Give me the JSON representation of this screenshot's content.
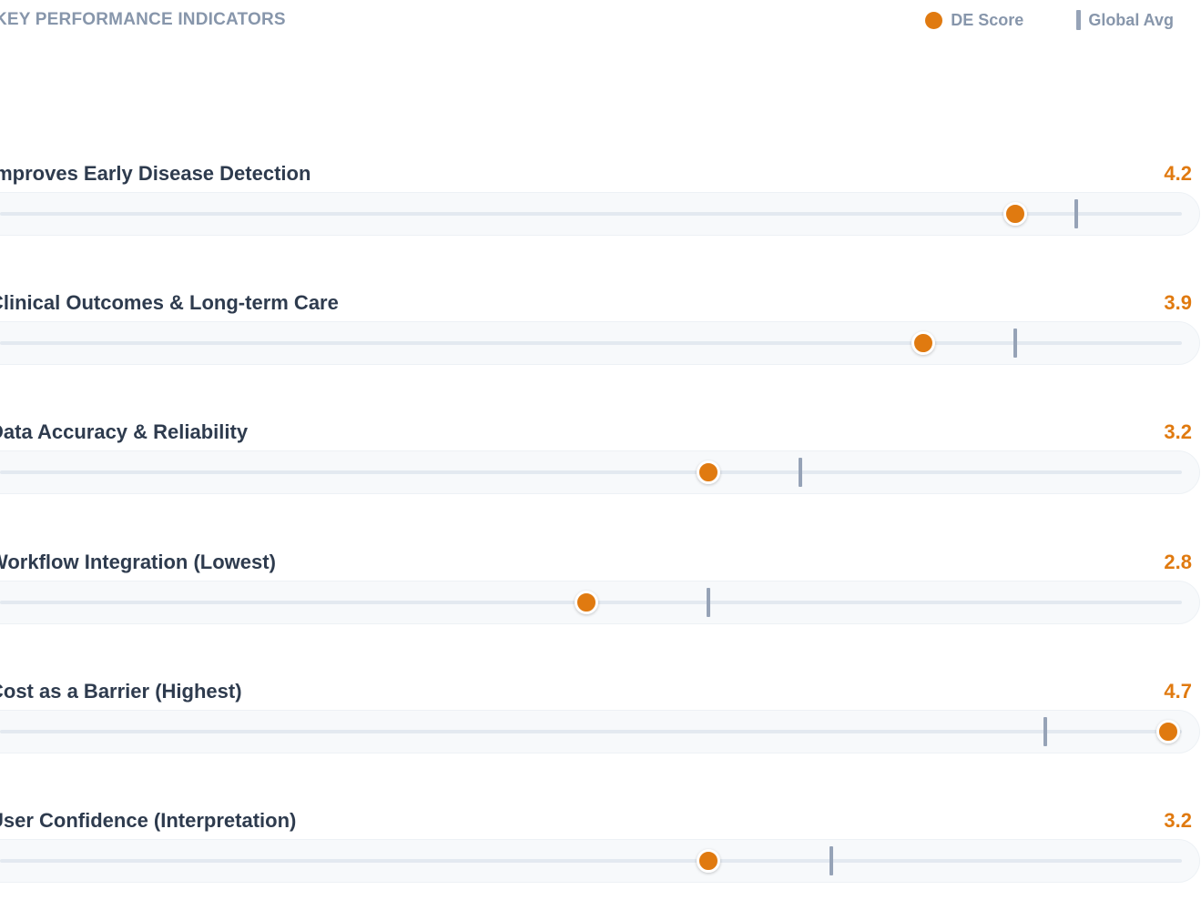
{
  "header": {
    "title": "KEY PERFORMANCE INDICATORS",
    "legend": {
      "score_label": "DE Score",
      "avg_label": "Global Avg"
    }
  },
  "colors": {
    "score": "#e07a10",
    "avg": "#96a3b7",
    "label": "#2e3b4e",
    "muted": "#8796ab"
  },
  "chart_data": {
    "type": "dot-range",
    "title": "KEY PERFORMANCE INDICATORS",
    "series": [
      {
        "name": "DE Score",
        "values": [
          4.2,
          3.9,
          3.2,
          2.8,
          4.7,
          3.2
        ]
      },
      {
        "name": "Global Avg",
        "values": [
          4.4,
          4.2,
          3.5,
          3.2,
          4.3,
          3.6
        ]
      }
    ],
    "categories": [
      "Improves Early Disease Detection",
      "Clinical Outcomes & Long-term Care",
      "Data Accuracy & Reliability",
      "Workflow Integration (Lowest)",
      "Cost as a Barrier (Highest)",
      "User Confidence (Interpretation)"
    ],
    "value_labels": [
      "4.2",
      "3.9",
      "3.2",
      "2.8",
      "4.7",
      "3.2"
    ],
    "xlim": [
      1,
      5
    ]
  }
}
